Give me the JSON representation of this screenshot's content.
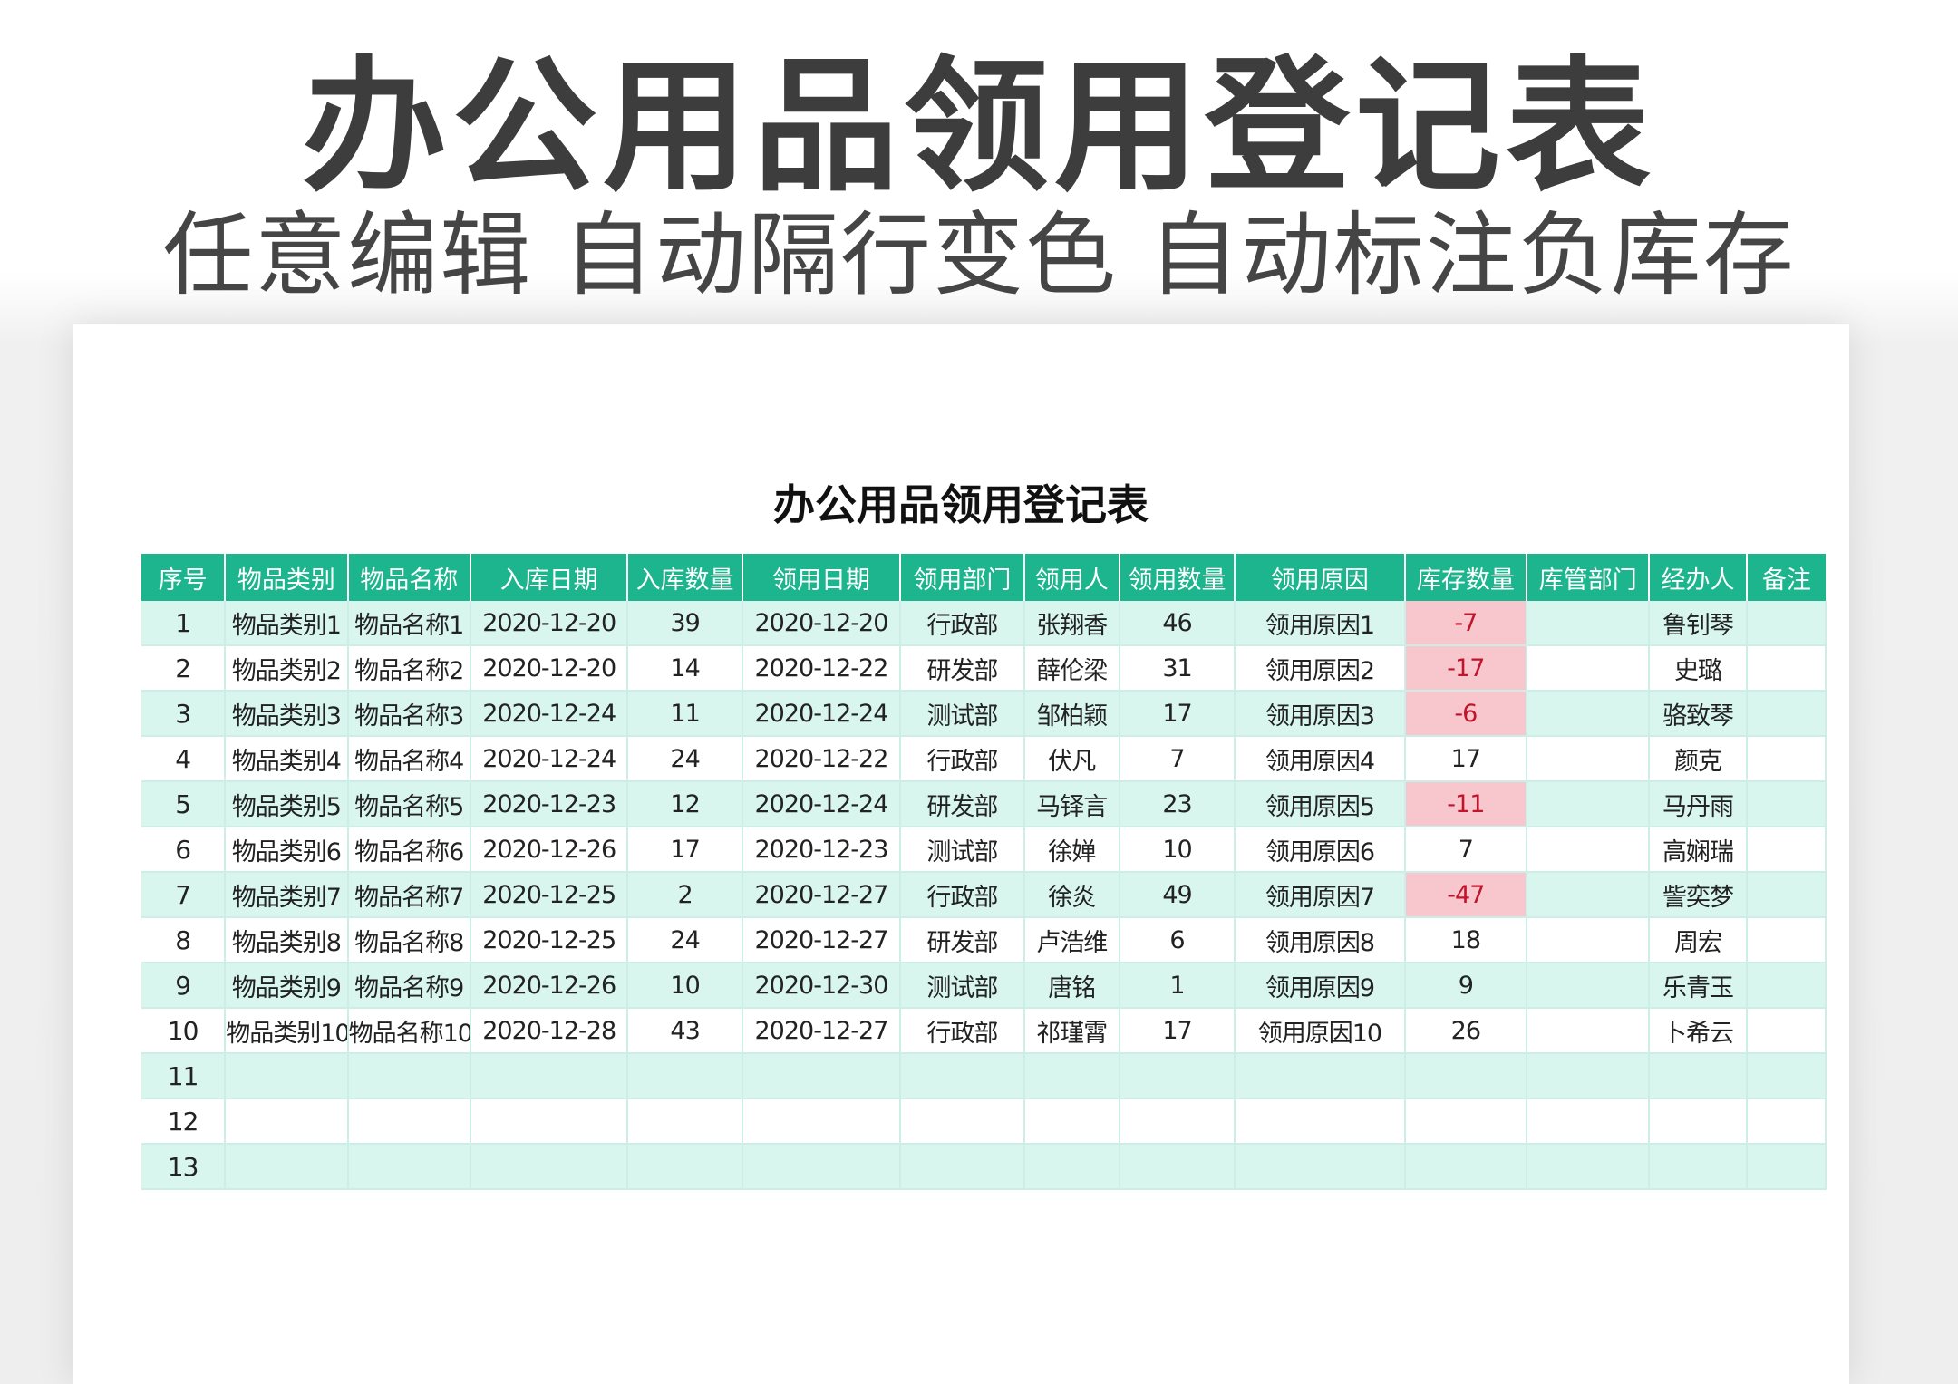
{
  "hero": {
    "title": "办公用品领用登记表",
    "subtitle": "任意编辑 自动隔行变色 自动标注负库存"
  },
  "sheet": {
    "title": "办公用品领用登记表",
    "columns": [
      "序号",
      "物品类别",
      "物品名称",
      "入库日期",
      "入库数量",
      "领用日期",
      "领用部门",
      "领用人",
      "领用数量",
      "领用原因",
      "库存数量",
      "库管部门",
      "经办人",
      "备注"
    ],
    "rows": [
      [
        "1",
        "物品类别1",
        "物品名称1",
        "2020-12-20",
        "39",
        "2020-12-20",
        "行政部",
        "张翔香",
        "46",
        "领用原因1",
        "-7",
        "",
        "鲁钊琴",
        ""
      ],
      [
        "2",
        "物品类别2",
        "物品名称2",
        "2020-12-20",
        "14",
        "2020-12-22",
        "研发部",
        "薛伦梁",
        "31",
        "领用原因2",
        "-17",
        "",
        "史璐",
        ""
      ],
      [
        "3",
        "物品类别3",
        "物品名称3",
        "2020-12-24",
        "11",
        "2020-12-24",
        "测试部",
        "邹柏颖",
        "17",
        "领用原因3",
        "-6",
        "",
        "骆致琴",
        ""
      ],
      [
        "4",
        "物品类别4",
        "物品名称4",
        "2020-12-24",
        "24",
        "2020-12-22",
        "行政部",
        "伏凡",
        "7",
        "领用原因4",
        "17",
        "",
        "颜克",
        ""
      ],
      [
        "5",
        "物品类别5",
        "物品名称5",
        "2020-12-23",
        "12",
        "2020-12-24",
        "研发部",
        "马铎言",
        "23",
        "领用原因5",
        "-11",
        "",
        "马丹雨",
        ""
      ],
      [
        "6",
        "物品类别6",
        "物品名称6",
        "2020-12-26",
        "17",
        "2020-12-23",
        "测试部",
        "徐婵",
        "10",
        "领用原因6",
        "7",
        "",
        "高娴瑞",
        ""
      ],
      [
        "7",
        "物品类别7",
        "物品名称7",
        "2020-12-25",
        "2",
        "2020-12-27",
        "行政部",
        "徐炎",
        "49",
        "领用原因7",
        "-47",
        "",
        "訾奕梦",
        ""
      ],
      [
        "8",
        "物品类别8",
        "物品名称8",
        "2020-12-25",
        "24",
        "2020-12-27",
        "研发部",
        "卢浩维",
        "6",
        "领用原因8",
        "18",
        "",
        "周宏",
        ""
      ],
      [
        "9",
        "物品类别9",
        "物品名称9",
        "2020-12-26",
        "10",
        "2020-12-30",
        "测试部",
        "唐铭",
        "1",
        "领用原因9",
        "9",
        "",
        "乐青玉",
        ""
      ],
      [
        "10",
        "物品类别10",
        "物品名称10",
        "2020-12-28",
        "43",
        "2020-12-27",
        "行政部",
        "祁瑾霄",
        "17",
        "领用原因10",
        "26",
        "",
        "卜希云",
        ""
      ],
      [
        "11",
        "",
        "",
        "",
        "",
        "",
        "",
        "",
        "",
        "",
        "",
        "",
        "",
        ""
      ],
      [
        "12",
        "",
        "",
        "",
        "",
        "",
        "",
        "",
        "",
        "",
        "",
        "",
        "",
        ""
      ],
      [
        "13",
        "",
        "",
        "",
        "",
        "",
        "",
        "",
        "",
        "",
        "",
        "",
        "",
        ""
      ]
    ]
  },
  "colors": {
    "header_bg": "#1db58e",
    "band_row": "#d8f6ee",
    "negative_bg": "#f8c7cd",
    "negative_text": "#c0152b"
  }
}
